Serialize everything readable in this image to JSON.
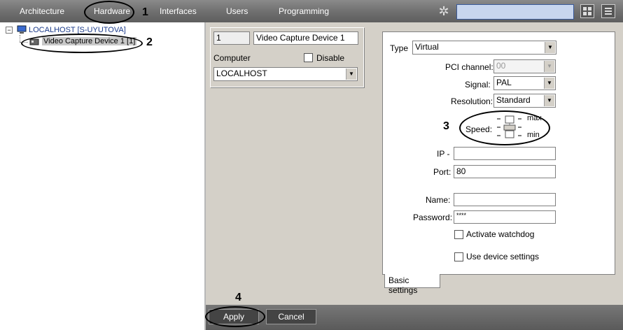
{
  "nav": {
    "tabs": [
      "Architecture",
      "Hardware",
      "Interfaces",
      "Users",
      "Programming"
    ],
    "search_value": ""
  },
  "tree": {
    "root_label": "LOCALHOST [S-UYUTOVA]",
    "child_label": "Video Capture Device 1 [1]"
  },
  "device": {
    "id": "1",
    "name": "Video Capture Device 1",
    "computer_label": "Computer",
    "disable_label": "Disable",
    "computer_value": "LOCALHOST"
  },
  "settings": {
    "type_label": "Type",
    "type_value": "Virtual",
    "pci_label": "PCI channel:",
    "pci_value": "00",
    "signal_label": "Signal:",
    "signal_value": "PAL",
    "resolution_label": "Resolution:",
    "resolution_value": "Standard",
    "speed_label": "Speed:",
    "speed_max": "max",
    "speed_min": "min",
    "ip_label": "IP -",
    "ip_value": "",
    "port_label": "Port:",
    "port_value": "80",
    "name_label": "Name:",
    "name_value": "",
    "password_label": "Password:",
    "password_value": "****",
    "watchdog_label": "Activate watchdog",
    "use_settings_label": "Use device settings",
    "tab_label": "Basic settings"
  },
  "buttons": {
    "apply": "Apply",
    "cancel": "Cancel"
  },
  "annotations": [
    "1",
    "2",
    "3",
    "4"
  ]
}
